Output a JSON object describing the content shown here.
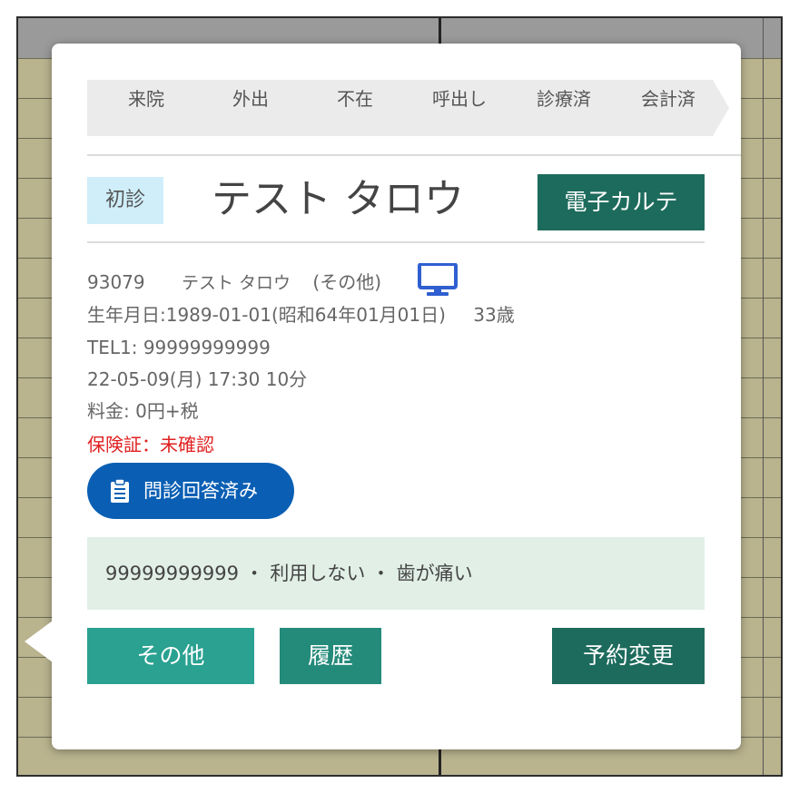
{
  "status_steps": [
    "来院",
    "外出",
    "不在",
    "呼出し",
    "診療済",
    "会計済"
  ],
  "patient": {
    "visit_badge": "初診",
    "name": "テスト タロウ",
    "id": "93079",
    "name_detail": "テスト タロウ",
    "category": "(その他)",
    "birth": "生年月日:1989-01-01(昭和64年01月01日)",
    "age": "33歳",
    "tel": "TEL1: 99999999999",
    "appointment": "22-05-09(月) 17:30 10分",
    "fee": "料金: 0円+税",
    "insurance": "保険証：未確認"
  },
  "buttons": {
    "chart": "電子カルテ",
    "questionnaire": "問診回答済み",
    "other": "その他",
    "history": "履歴",
    "change": "予約変更"
  },
  "memo": "99999999999 ・ 利用しない ・ 歯が痛い",
  "icons": {
    "online": "monitor-icon",
    "questionnaire": "clipboard-icon"
  },
  "colors": {
    "primary_dark": "#1d6b5c",
    "primary": "#2aa191",
    "pill_blue": "#0a5fb4",
    "monitor_blue": "#2f5fd0",
    "warning_red": "#e02020",
    "badge_bg": "#cfeefa",
    "memo_bg": "#e1efe7"
  }
}
